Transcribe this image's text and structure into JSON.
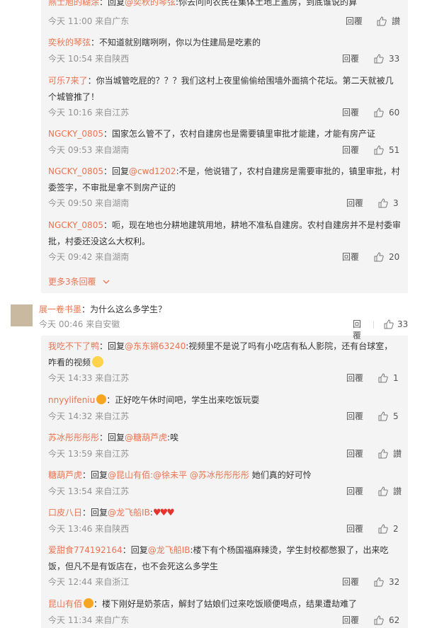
{
  "top_comments": [
    {
      "user": "燕士旭的糊涂",
      "reply_label": "：回复",
      "mention": "@奕秋的琴弦",
      "text": ":你去问问农民在集体土地上盖房，到底谁说的算",
      "time": "今天 11:00 来自广东",
      "reply": "回覆",
      "likes": "讃"
    },
    {
      "user": "奕秋的琴弦",
      "reply_label": "",
      "mention": "",
      "text": "：不知道就别瞎咧咧，你以为住建局是吃素的",
      "time": "今天 10:54 来自陕西",
      "reply": "回覆",
      "likes": "33"
    },
    {
      "user": "可乐7来了",
      "reply_label": "",
      "mention": "",
      "text": "：你当城管吃屁的？？？我们这村上夜里偷偷给围墙外面搞个花坛。第二天就被几个城管推了！",
      "time": "今天 10:16 来自江苏",
      "reply": "回覆",
      "likes": "60"
    },
    {
      "user": "NGCKY_0805",
      "reply_label": "",
      "mention": "",
      "text": "：国家怎么管不了，农村自建房也是需要镇里审批才能建，才能有房产证",
      "time": "今天 09:53 来自湖南",
      "reply": "回覆",
      "likes": "51"
    },
    {
      "user": "NGCKY_0805",
      "reply_label": "：回复",
      "mention": "@cwd1202",
      "text": ":不是，他说错了，农村自建房是需要审批的，镇里审批，村委签字，不审批是拿不到房产证的",
      "time": "今天 09:50 来自湖南",
      "reply": "回覆",
      "likes": "3"
    },
    {
      "user": "NGCKY_0805",
      "reply_label": "",
      "mention": "",
      "text": "：呃，现在地也分耕地建筑用地，耕地不准私自建房。农村自建房并不是村委审批，村委还没这么大权利。",
      "time": "今天 09:42 来自湖南",
      "reply": "回覆",
      "likes": "20"
    }
  ],
  "more_replies": "更多3条回覆",
  "main_comment": {
    "user": "展一卷书墨",
    "text": "：为什么这么多学生？",
    "time": "今天 00:46 来自安徽",
    "reply": "回覆",
    "likes": "33"
  },
  "sub_comments": [
    {
      "user": "我吃不下了鸭",
      "reply_label": "：回复",
      "mention": "@东东锵63240",
      "text": ":视频里不是说了吗有小吃店有私人影院，还有台球室，咋看的视频",
      "time": "今天 14:33 来自江苏",
      "reply": "回覆",
      "likes": "1"
    },
    {
      "user": "nnyylifeniu",
      "reply_label": "",
      "mention": "",
      "text": "：正好吃午休时间吧，学生出来吃饭玩耍",
      "time": "今天 14:32 来自江苏",
      "reply": "回覆",
      "likes": "5"
    },
    {
      "user": "苏冰彤彤彤彤",
      "reply_label": "：回复",
      "mention": "@糖葫芦虎",
      "text": ":唉",
      "time": "今天 13:59 来自江苏",
      "reply": "回覆",
      "likes": "讃"
    },
    {
      "user": "糖葫芦虎",
      "reply_label": "：回复",
      "mention": "@昆山有佰:@徐未平 @苏冰彤彤彤彤",
      "text": " 她们真的好可怜",
      "time": "今天 13:54 来自江苏",
      "reply": "回覆",
      "likes": "讃"
    },
    {
      "user": "口皮八日",
      "reply_label": "：回复",
      "mention": "@龙飞船IB",
      "text": ":",
      "time": "今天 13:46 来自陕西",
      "reply": "回覆",
      "likes": "2"
    },
    {
      "user": "爱甜食774192164",
      "reply_label": "：回复",
      "mention": "@龙飞船IB",
      "text": ":楼下有个杨国福麻辣烫，学生封校都憋狠了，出来吃饭，但凡不是有饭店在，也不会死这么多学生",
      "time": "今天 12:44 来自浙江",
      "reply": "回覆",
      "likes": "32"
    },
    {
      "user": "昆山有佰",
      "reply_label": "",
      "mention": "",
      "text": "：楼下刚好是奶茶店，解封了姑娘们过来吃饭顺便喝点，结果遭劫难了",
      "time": "今天 11:34 来自广东",
      "reply": "回覆",
      "likes": "62"
    }
  ]
}
